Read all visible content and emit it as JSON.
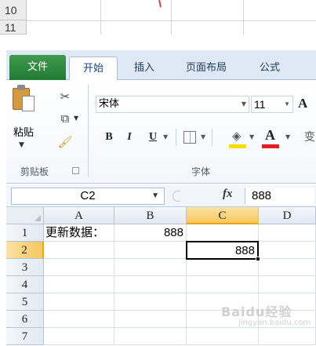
{
  "previous_sheet": {
    "rows": [
      "10",
      "11"
    ]
  },
  "tabs": {
    "file": "文件",
    "home": "开始",
    "insert": "插入",
    "page_layout": "页面布局",
    "formulas": "公式"
  },
  "ribbon": {
    "clipboard": {
      "paste_label": "粘贴",
      "group_label": "剪贴板"
    },
    "font": {
      "font_name": "宋体",
      "font_size": "11",
      "bold": "B",
      "italic": "I",
      "underline": "U",
      "font_color_glyph": "A",
      "grow_glyph": "A",
      "group_label": "字体",
      "partial_glyph": "变"
    }
  },
  "formula_bar": {
    "name_box": "C2",
    "fx": "fx",
    "value": "888"
  },
  "sheet": {
    "columns": [
      "A",
      "B",
      "C",
      "D"
    ],
    "selected_column": "C",
    "rows": [
      "1",
      "2",
      "3",
      "4",
      "5",
      "6",
      "7"
    ],
    "selected_row": "2",
    "cells": {
      "A1": "更新数据：",
      "B1": "888",
      "C2": "888"
    }
  },
  "watermark": {
    "name": "Baidu经验",
    "url": "jingyan.baidu.com"
  },
  "colors": {
    "file_tab": "#2a8a3c",
    "selection_header": "#f6c75e",
    "ribbon_bg": "#dfe9f5"
  }
}
